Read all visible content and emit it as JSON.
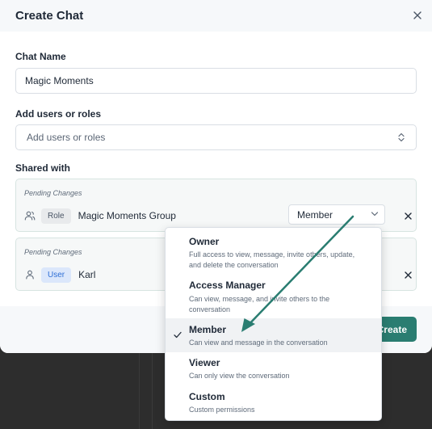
{
  "modal": {
    "title": "Create Chat",
    "close_icon": "close-icon"
  },
  "form": {
    "chat_name_label": "Chat Name",
    "chat_name_value": "Magic Moments",
    "add_users_label": "Add users or roles",
    "add_users_placeholder": "Add users or roles",
    "shared_with_label": "Shared with"
  },
  "shared": [
    {
      "pending": "Pending Changes",
      "icon": "users-group-icon",
      "badge": "Role",
      "name": "Magic Moments Group",
      "permission": "Member"
    },
    {
      "pending": "Pending Changes",
      "icon": "user-icon",
      "badge": "User",
      "name": "Karl"
    }
  ],
  "footer": {
    "create_label": "Create"
  },
  "permission_menu": {
    "selected": "Member",
    "options": [
      {
        "label": "Owner",
        "desc": "Full access to view, message, invite others, update, and delete the conversation"
      },
      {
        "label": "Access Manager",
        "desc": "Can view, message, and invite others to the conversation"
      },
      {
        "label": "Member",
        "desc": "Can view and message in the conversation"
      },
      {
        "label": "Viewer",
        "desc": "Can only view the conversation"
      },
      {
        "label": "Custom",
        "desc": "Custom permissions"
      }
    ]
  },
  "colors": {
    "accent": "#2a7d71",
    "annotation_arrow": "#2a7d71"
  }
}
